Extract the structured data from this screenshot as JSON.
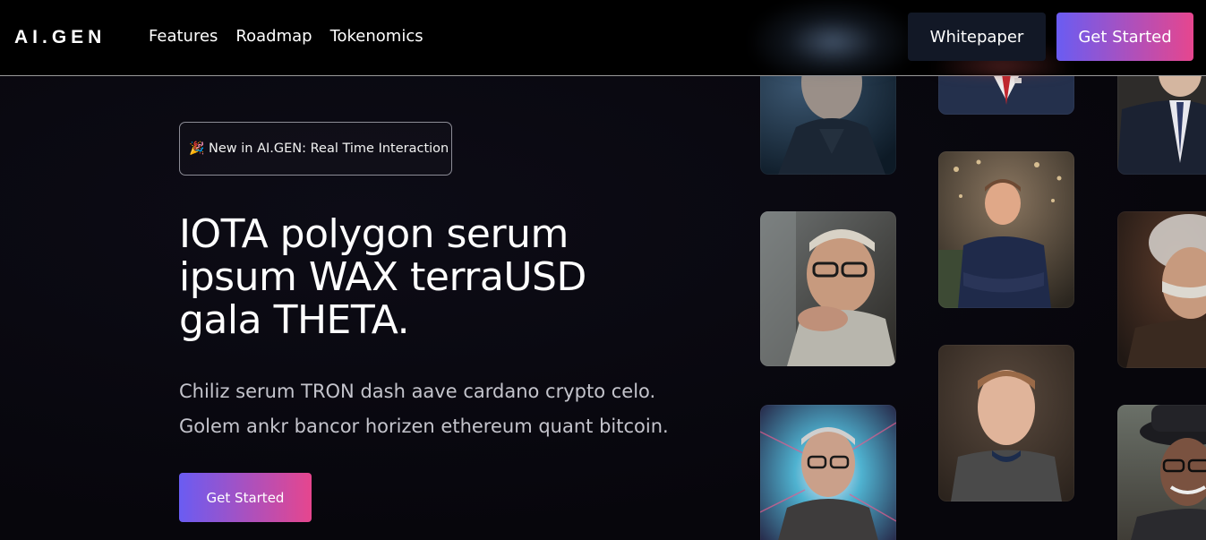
{
  "brand": {
    "logo": "AI.GEN"
  },
  "nav": {
    "links": [
      "Features",
      "Roadmap",
      "Tokenomics"
    ],
    "whitepaper_label": "Whitepaper",
    "get_started_label": "Get Started"
  },
  "hero": {
    "badge_icon": "party-popper-icon",
    "badge_text": "New in AI.GEN: Real Time Interaction",
    "headline": "IOTA polygon serum ipsum WAX terraUSD gala THETA.",
    "subtext_lines": [
      "Chiliz serum TRON dash aave cardano crypto celo.",
      "Golem ankr bancor horizen ethereum quant bitcoin."
    ],
    "cta_label": "Get Started"
  },
  "colors": {
    "background": "#07060c",
    "nav_background": "#000000",
    "whitepaper_button": "#121826",
    "gradient_start": "#6a5cf2",
    "gradient_end": "#e6468e"
  }
}
